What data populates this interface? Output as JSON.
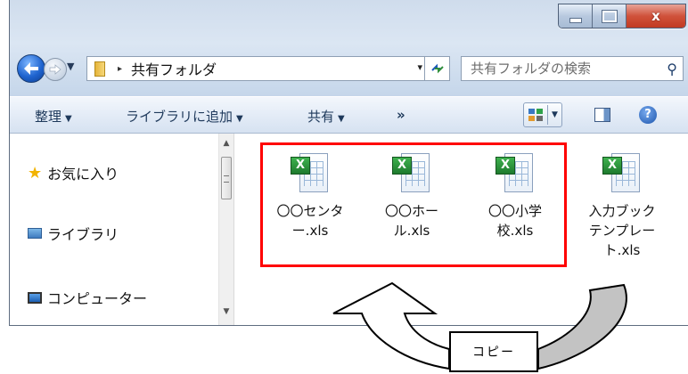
{
  "window": {
    "caption": {
      "minimize_icon": "minimize-icon",
      "maximize_icon": "maximize-icon",
      "close_label": "x"
    }
  },
  "address": {
    "crumb_separator": "▸",
    "crumb": "共有フォルダ",
    "dropdown": "▾",
    "refresh_icon": "refresh-icon"
  },
  "search": {
    "placeholder": "共有フォルダの検索",
    "icon": "search-icon"
  },
  "toolbar": {
    "organize": "整理",
    "add_to_library": "ライブラリに追加",
    "share": "共有",
    "more": "»",
    "help": "?"
  },
  "navpane": {
    "items": [
      {
        "label": "お気に入り",
        "icon": "star-icon"
      },
      {
        "label": "ライブラリ",
        "icon": "library-icon"
      },
      {
        "label": "コンピューター",
        "icon": "computer-icon"
      }
    ]
  },
  "files": [
    {
      "line1": "〇〇センタ",
      "line2": "ー.xls",
      "line3": ""
    },
    {
      "line1": "〇〇ホー",
      "line2": "ル.xls",
      "line3": ""
    },
    {
      "line1": "〇〇小学",
      "line2": "校.xls",
      "line3": ""
    },
    {
      "line1": "入力ブック",
      "line2": "テンプレー",
      "line3": "ト.xls"
    }
  ],
  "annotation": {
    "callout_text": "コピー",
    "highlight_color": "#ff0000"
  },
  "colors": {
    "excel_green": "#1e7a2d",
    "accent_blue": "#1f64cf"
  }
}
